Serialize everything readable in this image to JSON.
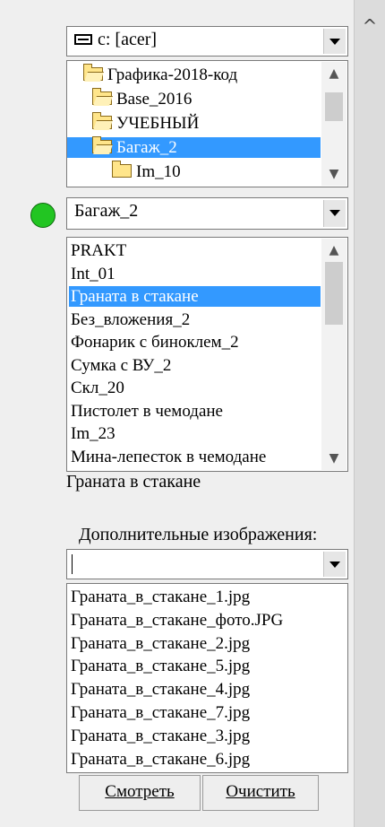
{
  "drive_select": {
    "value": "c: [acer]"
  },
  "folder_tree": [
    {
      "label": "Графика-2018-код",
      "open": true,
      "selected": false
    },
    {
      "label": "Base_2016",
      "open": true,
      "selected": false
    },
    {
      "label": "УЧЕБНЫЙ",
      "open": true,
      "selected": false
    },
    {
      "label": "Багаж_2",
      "open": true,
      "selected": true
    },
    {
      "label": "Im_10",
      "open": false,
      "selected": false
    }
  ],
  "category_select": {
    "value": "Багаж_2"
  },
  "items_list": [
    {
      "label": "PRAKT",
      "selected": false
    },
    {
      "label": "Int_01",
      "selected": false
    },
    {
      "label": "Граната в стакане",
      "selected": true
    },
    {
      "label": "Без_вложения_2",
      "selected": false
    },
    {
      "label": "Фонарик с биноклем_2",
      "selected": false
    },
    {
      "label": "Сумка с ВУ_2",
      "selected": false
    },
    {
      "label": "Скл_20",
      "selected": false
    },
    {
      "label": "Пистолет в чемодане",
      "selected": false
    },
    {
      "label": "Im_23",
      "selected": false
    },
    {
      "label": "Мина-лепесток в чемодане",
      "selected": false
    }
  ],
  "selected_item_caption": "Граната в стакане",
  "extra_images": {
    "label": "Дополнительные изображения:",
    "select_value": "",
    "files": [
      "Граната_в_стакане_1.jpg",
      "Граната_в_стакане_фото.JPG",
      "Граната_в_стакане_2.jpg",
      "Граната_в_стакане_5.jpg",
      "Граната_в_стакане_4.jpg",
      "Граната_в_стакане_7.jpg",
      "Граната_в_стакане_3.jpg",
      "Граната_в_стакане_6.jpg"
    ]
  },
  "buttons": {
    "view": "Смотреть",
    "clear": "Очистить"
  },
  "colors": {
    "selection": "#3399ff",
    "status_light": "#22c522"
  }
}
